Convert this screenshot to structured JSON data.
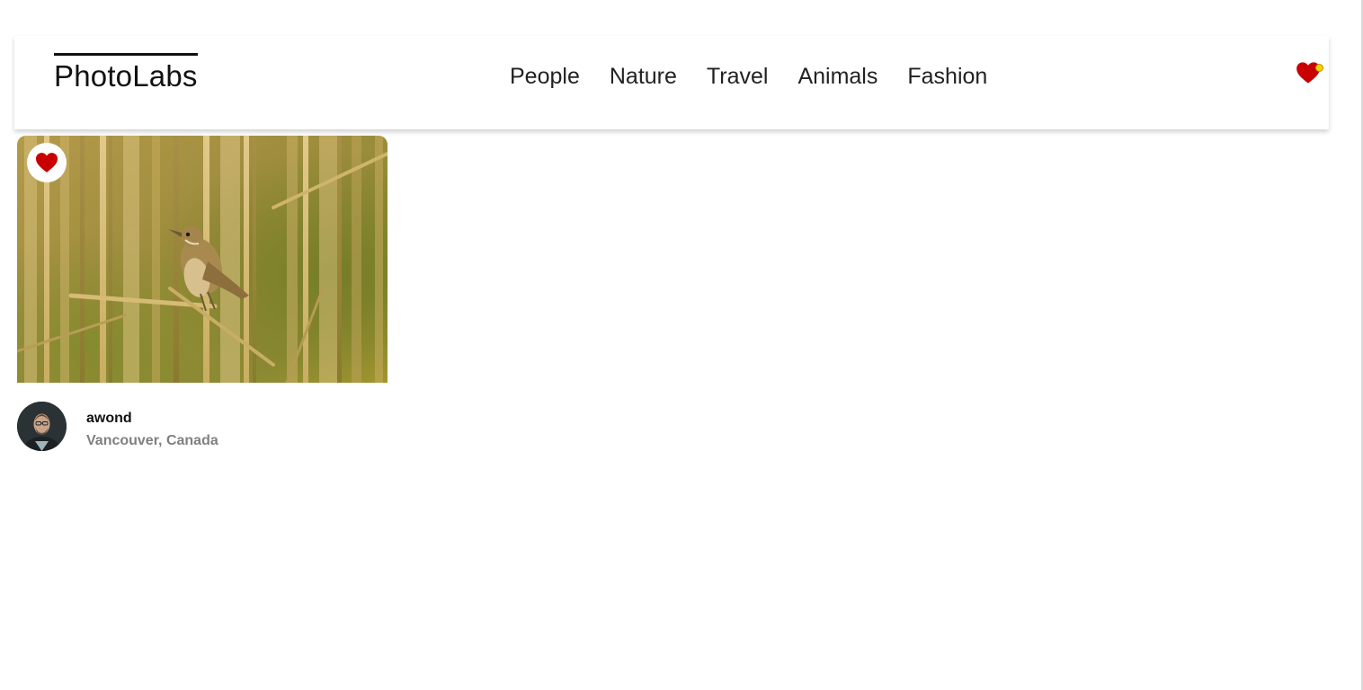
{
  "header": {
    "logo": "PhotoLabs",
    "topics": [
      {
        "label": "People"
      },
      {
        "label": "Nature"
      },
      {
        "label": "Travel"
      },
      {
        "label": "Animals"
      },
      {
        "label": "Fashion"
      }
    ],
    "fav_icon": "heart-icon",
    "notification_dot": true
  },
  "photos": [
    {
      "image": "bird-in-reeds",
      "favourited": true,
      "user": {
        "username": "awond",
        "location": "Vancouver, Canada",
        "avatar": "profile-avatar"
      }
    }
  ],
  "colors": {
    "heart": "#c80000",
    "notification": "#f2d100",
    "location_text": "#808080"
  }
}
